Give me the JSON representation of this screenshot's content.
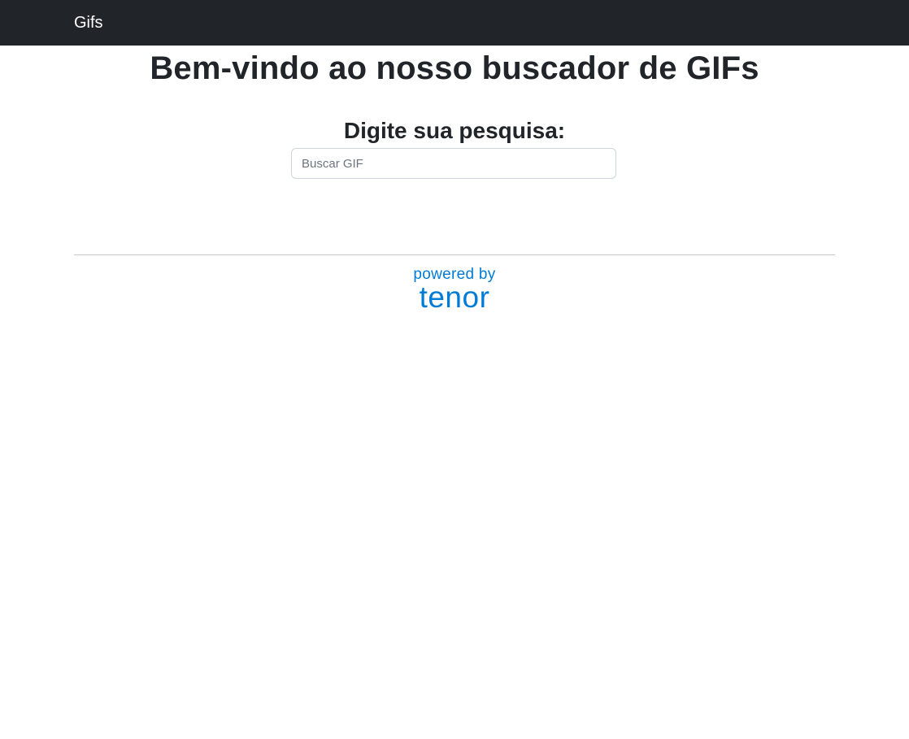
{
  "navbar": {
    "brand": "Gifs"
  },
  "main": {
    "title": "Bem-vindo ao nosso buscador de GIFs",
    "subtitle": "Digite sua pesquisa:",
    "search": {
      "placeholder": "Buscar GIF",
      "value": ""
    }
  },
  "footer": {
    "powered_by": "powered by",
    "brand": "tenor"
  },
  "colors": {
    "navbar_bg": "#212529",
    "tenor_blue": "#007cd6",
    "text": "#212529"
  }
}
